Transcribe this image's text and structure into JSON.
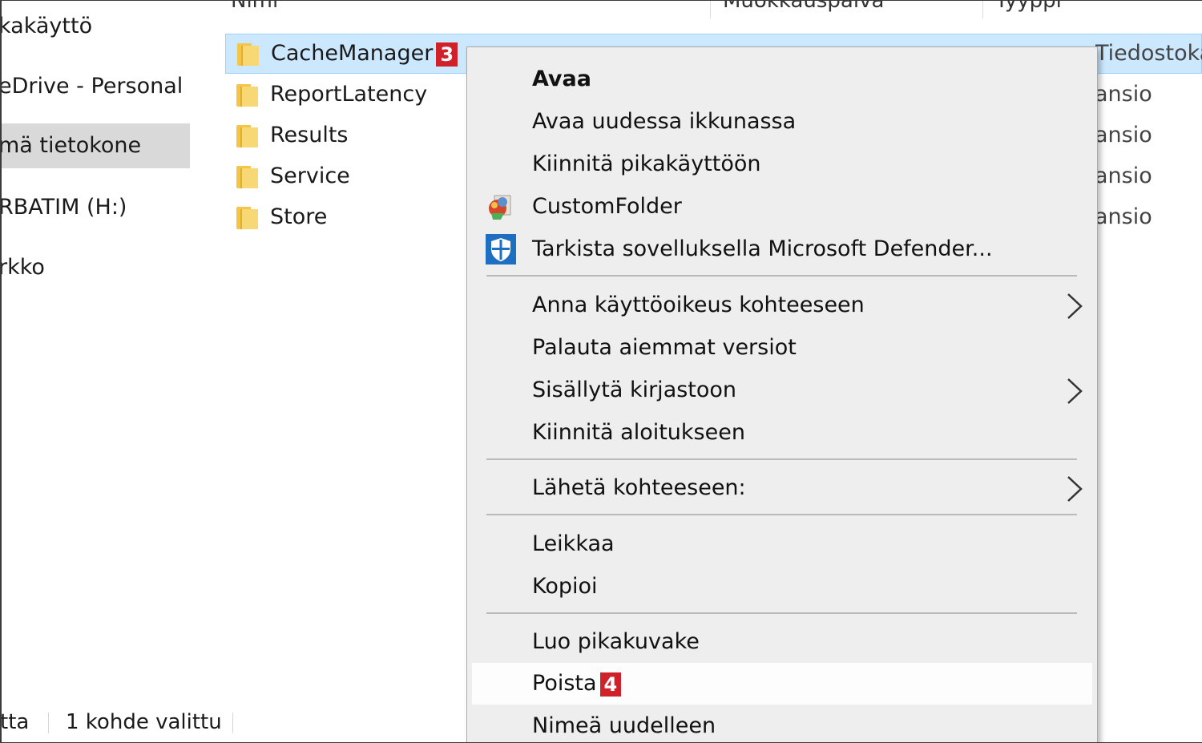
{
  "sidebar": {
    "items": [
      {
        "label": "kakäyttö"
      },
      {
        "label": "eDrive - Personal"
      },
      {
        "label": "mä tietokone"
      },
      {
        "label": "RBATIM (H:)"
      },
      {
        "label": "rkko"
      }
    ]
  },
  "columns": {
    "name": "Nimi",
    "modified": "Muokkauspäivä",
    "type": "Tyyppi"
  },
  "files": [
    {
      "name": "CacheManager",
      "badge": "3",
      "type": "Tiedostokansio"
    },
    {
      "name": "ReportLatency",
      "type": "ansio"
    },
    {
      "name": "Results",
      "type": "ansio"
    },
    {
      "name": "Service",
      "type": "ansio"
    },
    {
      "name": "Store",
      "type": "ansio"
    }
  ],
  "status": {
    "left": "tta",
    "selected": "1 kohde valittu"
  },
  "context_menu": {
    "items": [
      {
        "label": "Avaa"
      },
      {
        "label": "Avaa uudessa ikkunassa"
      },
      {
        "label": "Kiinnitä pikakäyttöön"
      },
      {
        "label": "CustomFolder",
        "icon": "customfolder-icon"
      },
      {
        "label": "Tarkista sovelluksella Microsoft Defender...",
        "icon": "defender-shield-icon"
      },
      {
        "label": "Anna käyttöoikeus kohteeseen"
      },
      {
        "label": "Palauta aiemmat versiot"
      },
      {
        "label": "Sisällytä kirjastoon"
      },
      {
        "label": "Kiinnitä aloitukseen"
      },
      {
        "label": "Lähetä kohteeseen:"
      },
      {
        "label": "Leikkaa"
      },
      {
        "label": "Kopioi"
      },
      {
        "label": "Luo pikakuvake"
      },
      {
        "label": "Poista",
        "badge": "4"
      },
      {
        "label": "Nimeä uudelleen"
      }
    ]
  },
  "colors": {
    "selection_bg": "#cce8ff",
    "menu_bg": "#eeeeee",
    "badge": "#d0212a",
    "folder": "#f8d775"
  }
}
